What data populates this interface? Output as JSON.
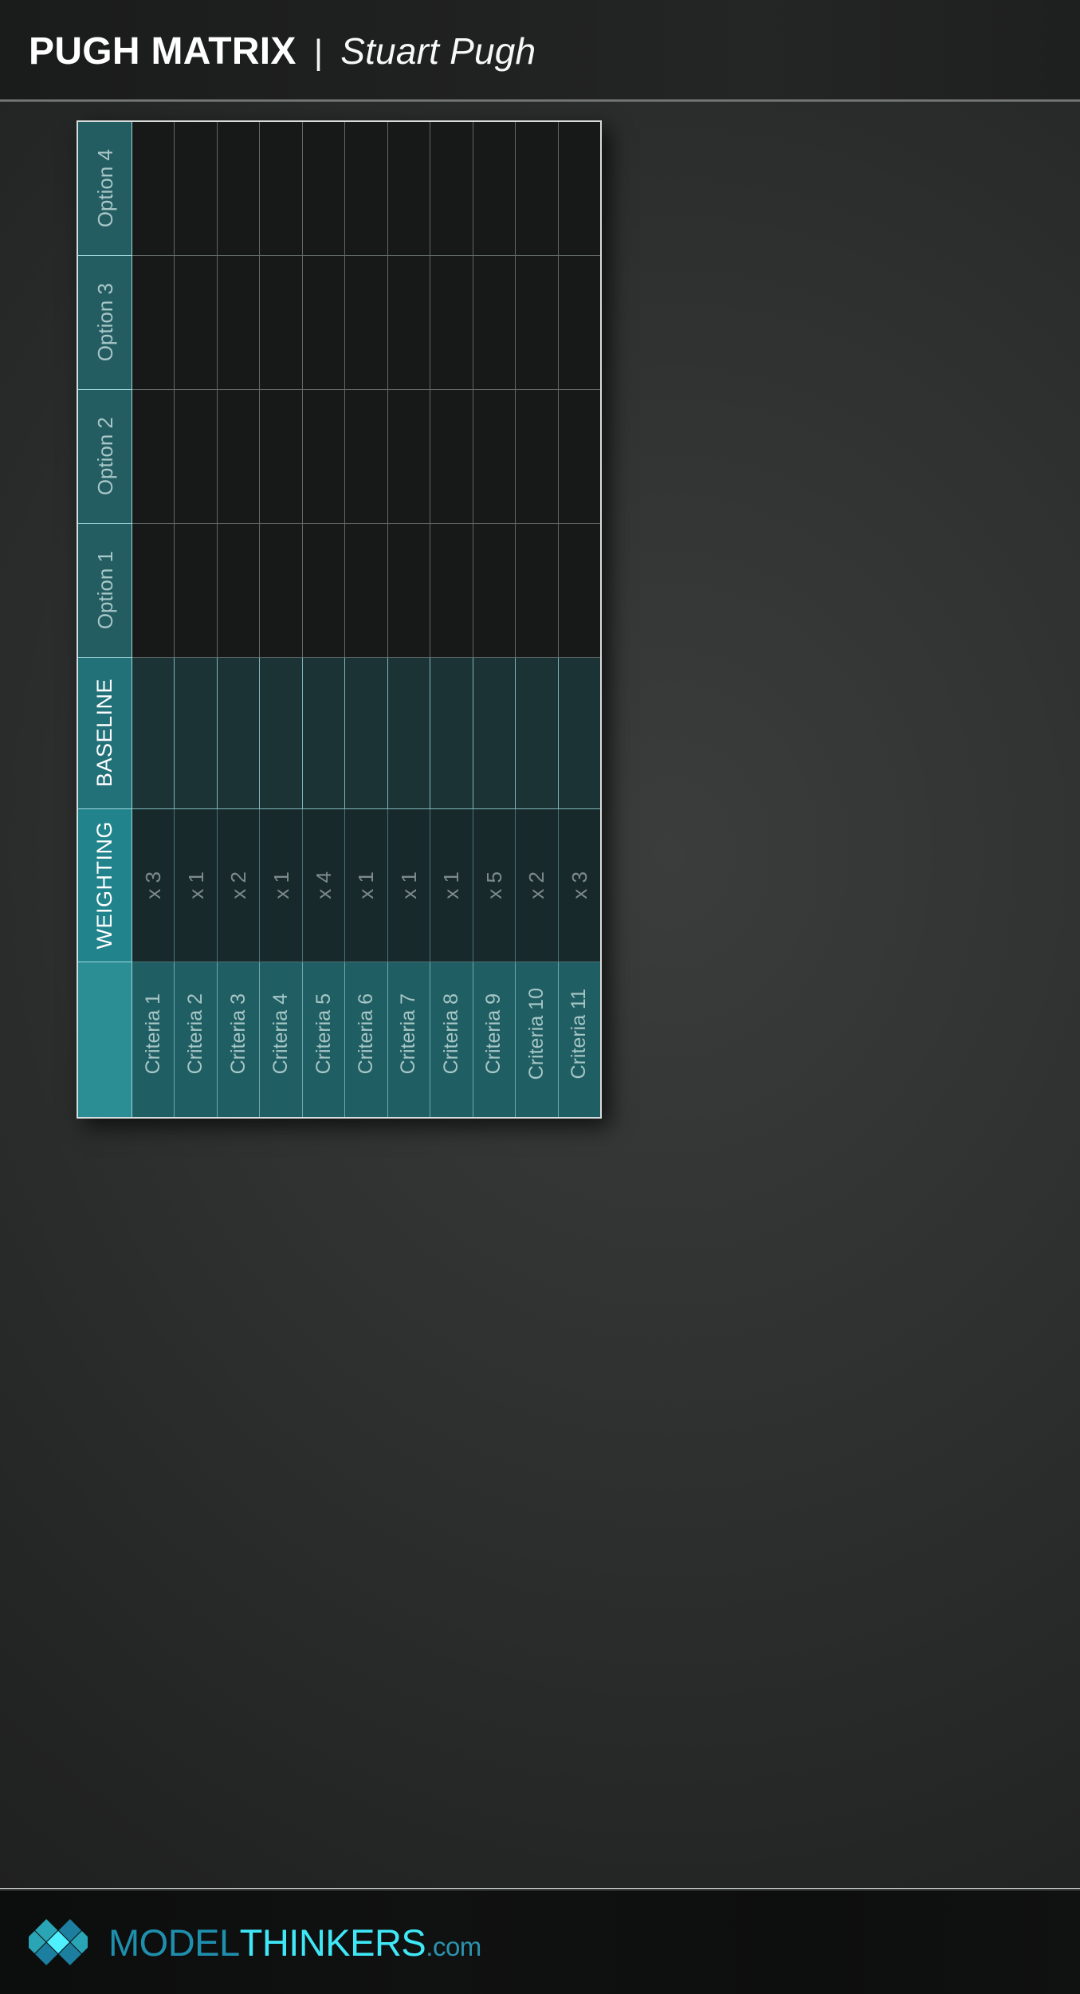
{
  "header": {
    "title": "PUGH MATRIX",
    "separator": "|",
    "author": "Stuart Pugh"
  },
  "matrix": {
    "options": [
      "Option 4",
      "Option 3",
      "Option 2",
      "Option 1"
    ],
    "baseline_label": "BASELINE",
    "weighting_label": "WEIGHTING",
    "criteria": [
      "Criteria 1",
      "Criteria 2",
      "Criteria 3",
      "Criteria 4",
      "Criteria 5",
      "Criteria 6",
      "Criteria 7",
      "Criteria 8",
      "Criteria 9",
      "Criteria 10",
      "Criteria 11"
    ],
    "weightings": [
      "x 3",
      "x 1",
      "x 2",
      "x 1",
      "x 4",
      "x 1",
      "x 1",
      "x 1",
      "x 5",
      "x 2",
      "x 3"
    ],
    "colors": {
      "option_header": "#235d62",
      "baseline_header": "#227179",
      "weighting_header": "#21848d",
      "criteria_corner": "#2a8e94",
      "criteria_cell": "#1f5f63",
      "option_cell": "#171818",
      "baseline_cell": "#1c3336",
      "weighting_cell": "#17292b",
      "outer_border": "#d9dcdc"
    }
  },
  "footer": {
    "logo": {
      "mark": "diamond-lattice-logo",
      "part_model": "MODEL",
      "part_thinkers": "THINKERS",
      "part_com": ".com",
      "color_model": "#1f8fae",
      "color_thinkers": "#3fe8f7",
      "color_com": "#2b93ae"
    }
  }
}
